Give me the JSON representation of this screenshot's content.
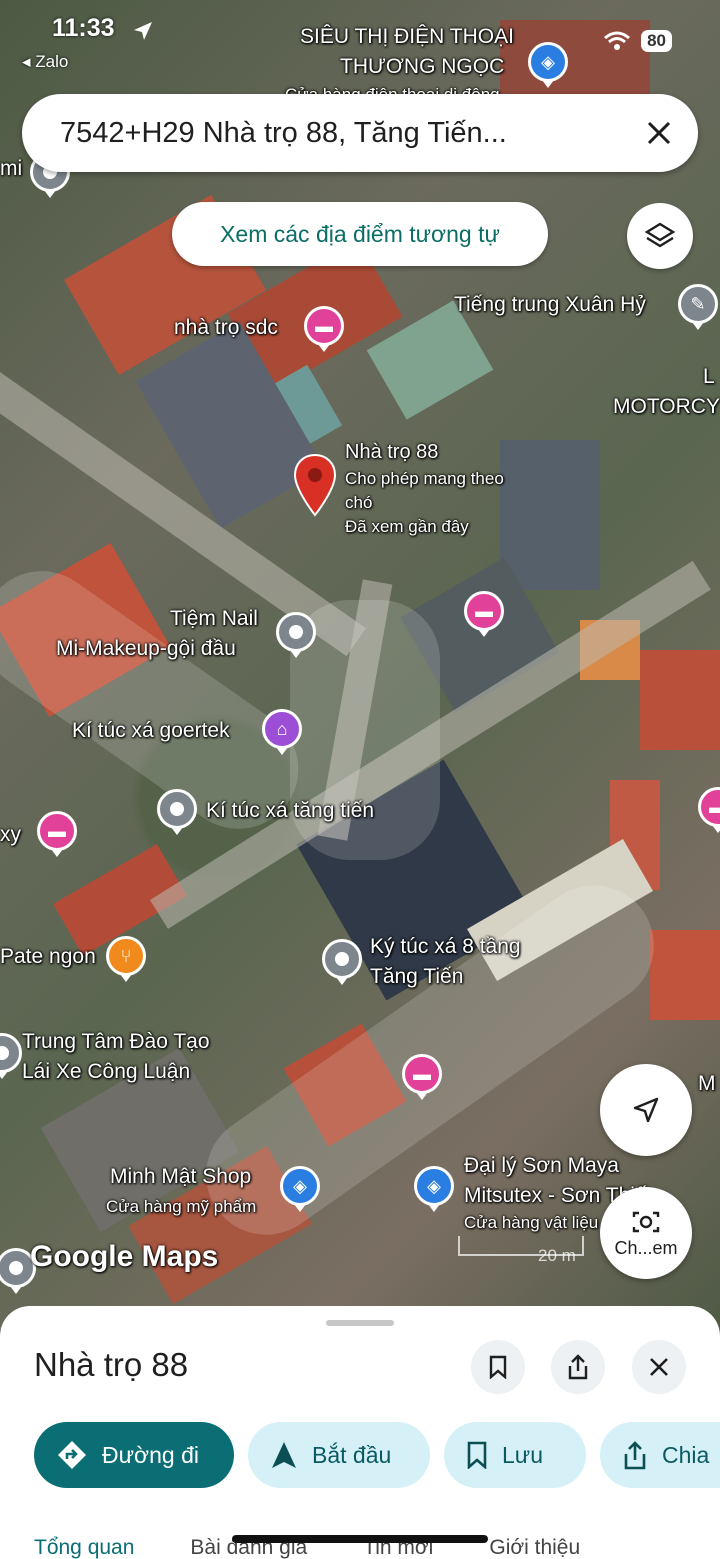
{
  "status_bar": {
    "time": "11:33",
    "back_app": "◂ Zalo",
    "battery": "80"
  },
  "search": {
    "query": "7542+H29 Nhà trọ 88, Tăng Tiến..."
  },
  "map": {
    "similar_places_button": "Xem các địa điểm tương tự",
    "selected_place": {
      "name": "Nhà trọ 88",
      "line1": "Cho phép mang theo",
      "line2": "chó",
      "line3": "Đã xem gần đây"
    },
    "labels": {
      "top_store_1": "SIÊU THỊ ĐIỆN THOẠI",
      "top_store_2": "THƯƠNG NGỌC",
      "top_store_3": "Cửa hàng điện thoại di động",
      "left_edge": "mi",
      "tieng_trung": "Tiếng trung Xuân Hỷ",
      "right_edge_1": "L",
      "right_edge_2": "MOTORCY",
      "nha_tro_sdc": "nhà trọ sdc",
      "tiem_nail_1": "Tiệm Nail",
      "tiem_nail_2": "Mi-Makeup-gội đầu",
      "ktx_goertek": "Kí túc xá goertek",
      "ktx_tang_tien": "Kí túc xá tăng tiến",
      "xy_edge": "xy",
      "pate": "Pate ngon",
      "ktx_8_tang_1": "Ký túc xá 8 tầng",
      "ktx_8_tang_2": "Tăng Tiến",
      "trung_tam_1": "Trung Tâm Đào Tạo",
      "trung_tam_2": "Lái Xe Công Luận",
      "minh_mat_1": "Minh Mật Shop",
      "minh_mat_2": "Cửa hàng mỹ phẩm",
      "dai_ly_1": "Đại lý Sơn Maya",
      "dai_ly_2": "Mitsutex - Sơn Thiết",
      "dai_ly_3": "Cửa hàng vật liệu",
      "m_edge": "M"
    },
    "logo": "Google Maps",
    "scale": "20 m",
    "lens_label": "Ch...em"
  },
  "sheet": {
    "title": "Nhà trọ 88",
    "actions": [
      {
        "label": "Đường đi"
      },
      {
        "label": "Bắt đầu"
      },
      {
        "label": "Lưu"
      },
      {
        "label": "Chia"
      }
    ],
    "tabs": [
      "Tổng quan",
      "Bài đánh giá",
      "Tin mới",
      "Giới thiệu"
    ]
  },
  "colors": {
    "accent": "#0b6e74",
    "chip_bg": "#d5f1f7",
    "pin_red": "#d93025",
    "poi_pink": "#e2419a"
  }
}
